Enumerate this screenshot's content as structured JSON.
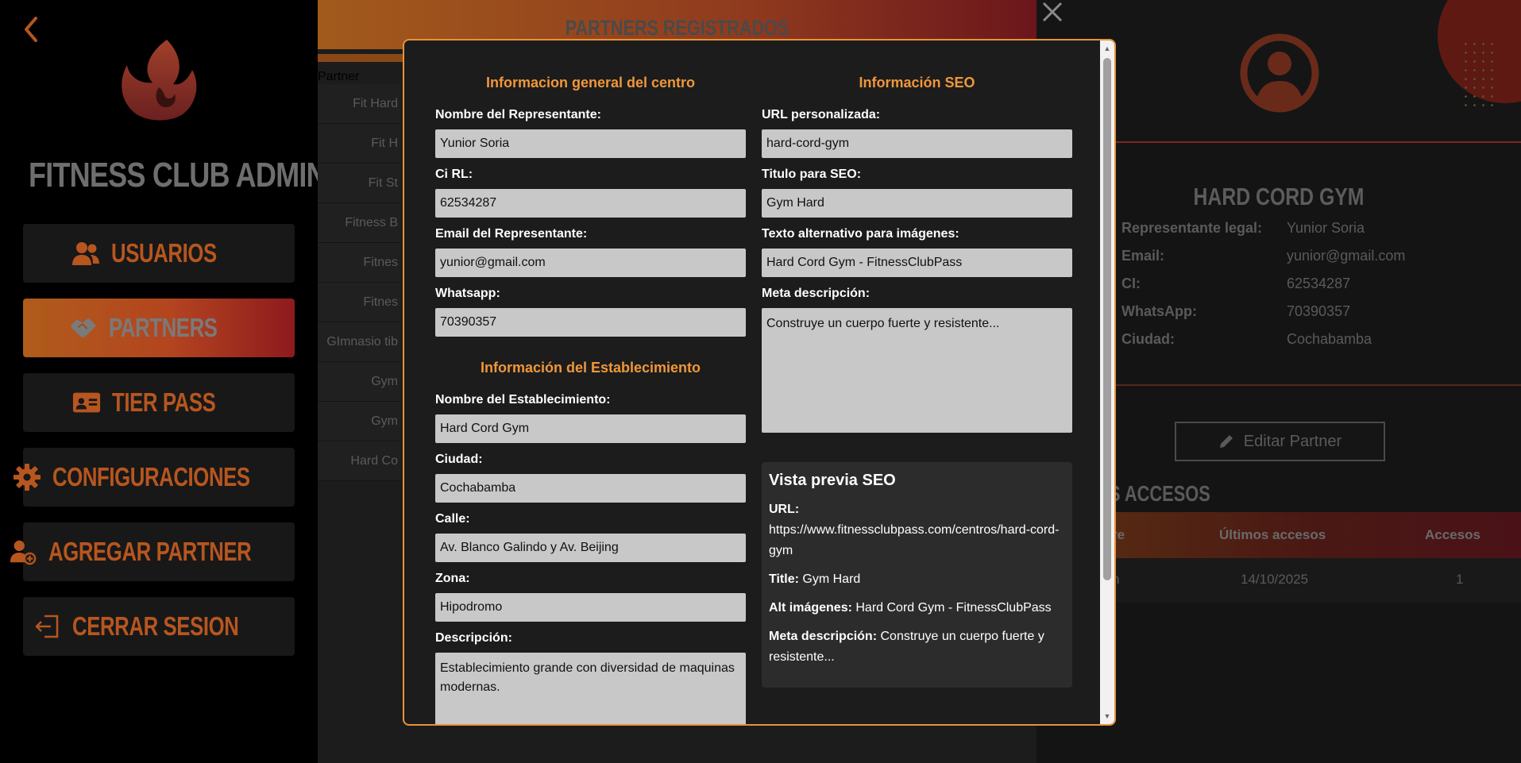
{
  "sidebar": {
    "brand": "FITNESS CLUB ADMIN",
    "nav": [
      {
        "label": "USUARIOS",
        "icon": "users-icon"
      },
      {
        "label": "PARTNERS",
        "icon": "handshake-icon"
      },
      {
        "label": "TIER PASS",
        "icon": "id-card-icon"
      },
      {
        "label": "CONFIGURACIONES",
        "icon": "gear-icon"
      },
      {
        "label": "AGREGAR PARTNER",
        "icon": "add-user-icon"
      },
      {
        "label": "CERRAR SESION",
        "icon": "logout-icon"
      }
    ]
  },
  "partners_list": {
    "title": "PARTNERS REGISTRADOS",
    "column_header": "Partner",
    "rows": [
      "Fit Hard",
      "Fit H",
      "Fit St",
      "Fitness B",
      "Fitnes",
      "Fitnes",
      "GImnasio tib",
      "Gym",
      "Gym",
      "Hard Co"
    ]
  },
  "detail": {
    "name": "HARD CORD GYM",
    "fields": [
      {
        "key": "Representante legal:",
        "value": "Yunior Soria"
      },
      {
        "key": "Email:",
        "value": "yunior@gmail.com"
      },
      {
        "key": "CI:",
        "value": "62534287"
      },
      {
        "key": "WhatsApp:",
        "value": "70390357"
      },
      {
        "key": "Ciudad:",
        "value": "Cochabamba"
      }
    ],
    "edit_button": "Editar Partner",
    "access_title": "S ACCESOS",
    "access_headers": [
      "re",
      "Últimos accesos",
      "Accesos"
    ],
    "access_row": [
      "n",
      "14/10/2025",
      "1"
    ]
  },
  "modal": {
    "general_title": "Informacion general del centro",
    "rep_name_label": "Nombre del Representante:",
    "rep_name": "Yunior Soria",
    "ci_label": "Ci RL:",
    "ci": "62534287",
    "email_label": "Email del Representante:",
    "email": "yunior@gmail.com",
    "whatsapp_label": "Whatsapp:",
    "whatsapp": "70390357",
    "estab_title": "Información del Establecimiento",
    "estab_name_label": "Nombre del Establecimiento:",
    "estab_name": "Hard Cord Gym",
    "city_label": "Ciudad:",
    "city": "Cochabamba",
    "street_label": "Calle:",
    "street": "Av. Blanco Galindo y Av. Beijing",
    "zone_label": "Zona:",
    "zone": "Hipodromo",
    "desc_label": "Descripción:",
    "desc": "Establecimiento grande con diversidad de maquinas modernas.",
    "seo_title": "Información SEO",
    "url_label": "URL personalizada:",
    "url": "hard-cord-gym",
    "seo_title_label": "Titulo para SEO:",
    "seo_title_value": "Gym Hard",
    "alt_label": "Texto alternativo para imágenes:",
    "alt": "Hard Cord Gym - FitnessClubPass",
    "meta_label": "Meta descripción:",
    "meta": "Construye un cuerpo fuerte y resistente...",
    "preview": {
      "heading": "Vista previa SEO",
      "url_key": "URL:",
      "url_value": "https://www.fitnessclubpass.com/centros/hard-cord-gym",
      "title_key": "Title:",
      "title_value": "Gym Hard",
      "alt_key": "Alt imágenes:",
      "alt_value": "Hard Cord Gym - FitnessClubPass",
      "meta_key": "Meta descripción:",
      "meta_value": "Construye un cuerpo fuerte y resistente..."
    }
  },
  "colors": {
    "accent": "#f0973a",
    "modal_border": "#e8923a",
    "nav_text": "#b7561f",
    "active_gradient_start": "#b05c1c",
    "active_gradient_end": "#8e1a1e"
  }
}
